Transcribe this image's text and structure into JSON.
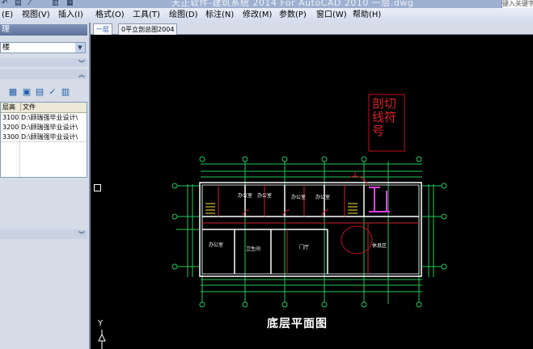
{
  "title_bar": {
    "title": "天正软件-建筑系统 2014   For AutoCAD 2010  一层.dwg",
    "search_placeholder": "键入关键字"
  },
  "menu": {
    "items": [
      "(E)",
      "视图(V)",
      "插入(I)",
      "格式(O)",
      "工具(T)",
      "绘图(D)",
      "标注(N)",
      "修改(M)",
      "参数(P)",
      "窗口(W)",
      "帮助(H)"
    ]
  },
  "side_panel": {
    "header": "理",
    "combo_value": "楼",
    "table": {
      "columns": [
        "层高",
        "文件"
      ],
      "rows": [
        [
          "3100",
          "D:\\顾瑞强毕业设计\\"
        ],
        [
          "3200",
          "D:\\顾瑞强毕业设计\\"
        ],
        [
          "3300",
          "D:\\顾瑞强毕业设计\\"
        ]
      ]
    }
  },
  "tabs": [
    "一层",
    "0平立剖总图2004"
  ],
  "active_tab": 0,
  "drawing": {
    "annotation_line1": "剖切",
    "annotation_line2": "线符",
    "annotation_line3": "号",
    "caption": "底层平面图",
    "ucs_label": "Y",
    "room_labels": [
      "办公室",
      "办公室",
      "办公室",
      "办公室",
      "办公室",
      "卫生间",
      "门厅",
      "休息区"
    ]
  },
  "colors": {
    "canvas_bg": "#000000",
    "drawing_green": "#22c85a",
    "annotation_red": "#e0202a",
    "wall": "#ffffff",
    "magenta": "#e040e0"
  }
}
